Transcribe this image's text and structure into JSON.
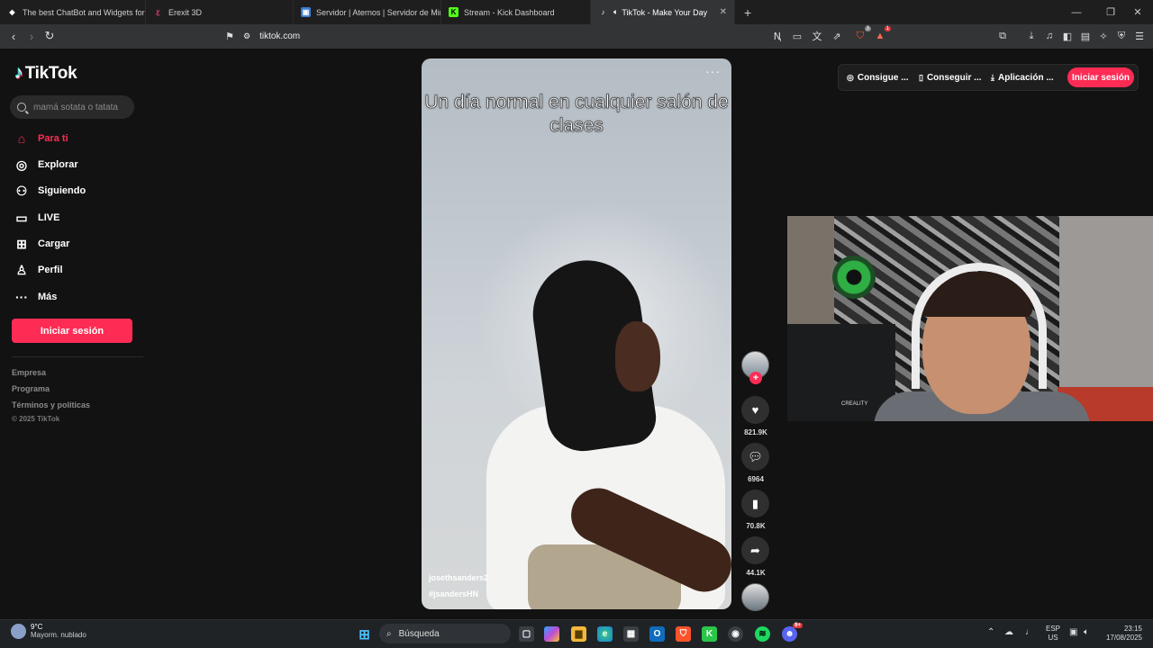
{
  "browser": {
    "tabs": [
      {
        "title": "The best ChatBot and Widgets for Ki",
        "icon": "diamond-icon",
        "color": "#ffffff"
      },
      {
        "title": "Erexit 3D",
        "icon": "erexit-icon",
        "color": "#e23c6b"
      },
      {
        "title": "Servidor | Aternos | Servidor de Mine",
        "icon": "aternos-icon",
        "color": "#3a7bd5"
      },
      {
        "title": "Stream - Kick Dashboard",
        "icon": "kick-icon",
        "color": "#53fc18"
      },
      {
        "title": "TikTok - Make Your Day",
        "icon": "tiktok-icon",
        "color": "#ffffff",
        "active": true
      }
    ],
    "url": "tiktok.com",
    "shields_badge": "3",
    "rewards_badge": "1"
  },
  "tiktok": {
    "logo_text": "TikTok",
    "search_placeholder": "mamá sotata o tatata",
    "nav": [
      {
        "label": "Para ti",
        "icon": "home-icon",
        "active": true
      },
      {
        "label": "Explorar",
        "icon": "compass-icon"
      },
      {
        "label": "Siguiendo",
        "icon": "following-icon"
      },
      {
        "label": "LIVE",
        "icon": "live-tv-icon"
      },
      {
        "label": "Cargar",
        "icon": "upload-icon"
      },
      {
        "label": "Perfil",
        "icon": "profile-icon"
      },
      {
        "label": "Más",
        "icon": "more-dots-icon"
      }
    ],
    "login_label": "Iniciar sesión",
    "footer": [
      "Empresa",
      "Programa",
      "Términos y políticas"
    ],
    "copyright": "© 2025 TikTok",
    "top_actions": [
      {
        "label": "Consigue ...",
        "icon": "coin-icon"
      },
      {
        "label": "Conseguir ...",
        "icon": "phone-icon"
      },
      {
        "label": "Aplicación ...",
        "icon": "download-icon"
      }
    ],
    "top_login": "Iniciar sesión",
    "accent": "#fe2c55"
  },
  "video": {
    "caption": "Un día normal en cualquier salón de clases",
    "username": "josethsanders2",
    "hashtag": "#jsandersHN",
    "likes": "821.9K",
    "comments": "6964",
    "saves": "70.8K",
    "shares": "44.1K"
  },
  "webcam": {
    "printer_label": "CREALITY"
  },
  "taskbar": {
    "temperature": "9°C",
    "weather": "Mayorm. nublado",
    "search_label": "Búsqueda",
    "lang_top": "ESP",
    "lang_bottom": "US",
    "time": "23:15",
    "date": "17/08/2025",
    "discord_badge": "9+"
  }
}
